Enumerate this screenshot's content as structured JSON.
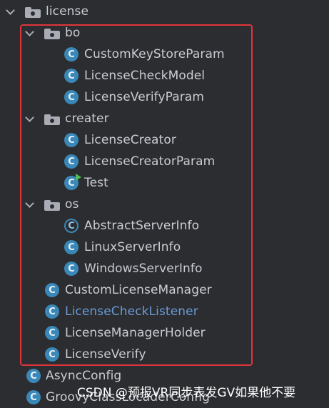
{
  "tree": {
    "items": [
      {
        "label": "license",
        "kind": "folder",
        "expanded": true,
        "icon": "package-folder-icon"
      },
      {
        "label": "bo",
        "kind": "folder",
        "expanded": true,
        "icon": "package-folder-icon"
      },
      {
        "label": "CustomKeyStoreParam",
        "kind": "class",
        "icon": "class-icon"
      },
      {
        "label": "LicenseCheckModel",
        "kind": "class",
        "icon": "class-icon"
      },
      {
        "label": "LicenseVerifyParam",
        "kind": "class",
        "icon": "class-icon"
      },
      {
        "label": "creater",
        "kind": "folder",
        "expanded": true,
        "icon": "package-folder-icon"
      },
      {
        "label": "LicenseCreator",
        "kind": "class",
        "icon": "class-icon"
      },
      {
        "label": "LicenseCreatorParam",
        "kind": "class",
        "icon": "class-icon"
      },
      {
        "label": "Test",
        "kind": "class",
        "icon": "runnable-class-icon"
      },
      {
        "label": "os",
        "kind": "folder",
        "expanded": true,
        "icon": "package-folder-icon"
      },
      {
        "label": "AbstractServerInfo",
        "kind": "class",
        "icon": "abstract-class-icon"
      },
      {
        "label": "LinuxServerInfo",
        "kind": "class",
        "icon": "class-icon"
      },
      {
        "label": "WindowsServerInfo",
        "kind": "class",
        "icon": "class-icon"
      },
      {
        "label": "CustomLicenseManager",
        "kind": "class",
        "icon": "class-icon"
      },
      {
        "label": "LicenseCheckListener",
        "kind": "class",
        "icon": "class-icon",
        "highlighted": true
      },
      {
        "label": "LicenseManagerHolder",
        "kind": "class",
        "icon": "class-icon"
      },
      {
        "label": "LicenseVerify",
        "kind": "class",
        "icon": "class-icon"
      },
      {
        "label": "AsyncConfig",
        "kind": "class",
        "icon": "class-icon"
      },
      {
        "label": "GroovyClassLocaderConfig",
        "kind": "class",
        "icon": "class-icon"
      }
    ]
  },
  "watermark": "CSDN @预报VR同步表发GV如果他不要",
  "colors": {
    "background": "#2b2d30",
    "text": "#c9ccd3",
    "highlighted_text": "#6a9bd8",
    "class_icon": "#3a88b8",
    "run_marker": "#4fbf5a",
    "annotation_box": "#e0343a"
  }
}
